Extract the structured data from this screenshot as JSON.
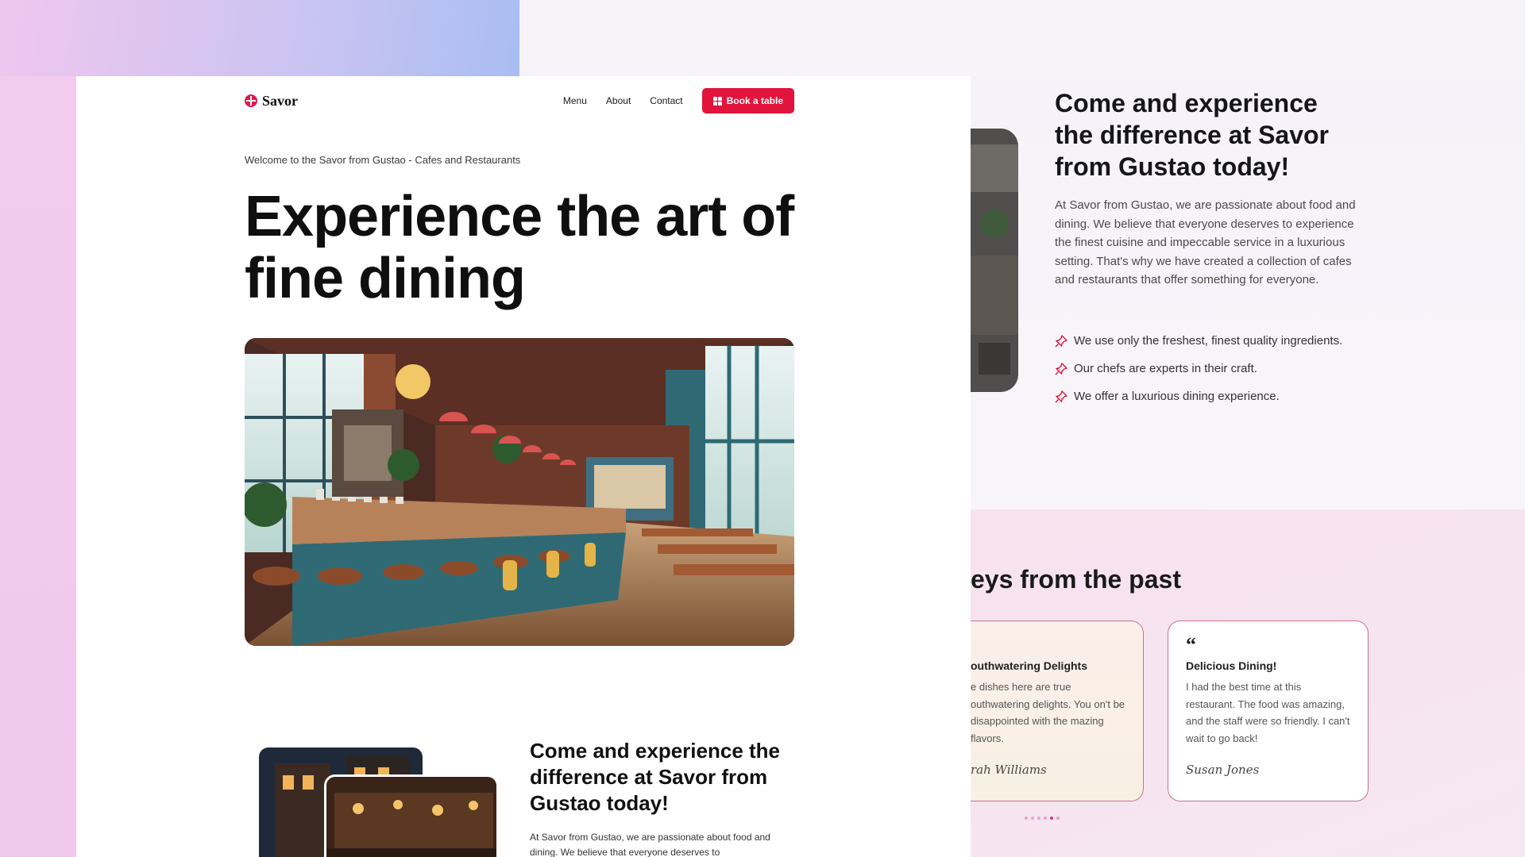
{
  "brand": {
    "name": "Savor",
    "accent": "#e0143c"
  },
  "nav": {
    "links": [
      {
        "label": "Menu"
      },
      {
        "label": "About"
      },
      {
        "label": "Contact"
      }
    ],
    "cta_label": "Book a table"
  },
  "hero": {
    "eyebrow": "Welcome to the Savor from Gustao - Cafes and Restaurants",
    "title": "Experience the art of fine dining"
  },
  "about": {
    "title": "Come and experience the difference at Savor from Gustao today!",
    "body": "At Savor from Gustao, we are passionate about food and dining. We believe that everyone deserves to experience the finest cuisine and impeccable service in a luxurious setting. That's why we have created a collection of cafes and restaurants that offer something for everyone.",
    "body_preview": "At Savor from Gustao, we are passionate about food and dining. We believe that everyone deserves to",
    "features": [
      "We use only the freshest, finest quality ingredients.",
      "Our chefs are experts in their craft.",
      "We offer a luxurious dining experience."
    ]
  },
  "testimonials": {
    "title_visible": "eys from the past",
    "cards": [
      {
        "title": "outhwatering Delights",
        "text": "e dishes here are true outhwatering delights. You on't be disappointed with the mazing flavors.",
        "author": "rah Williams"
      },
      {
        "title": "Delicious Dining!",
        "text": "I had the best time at this restaurant. The food was amazing, and the staff were so friendly. I can't wait to go back!",
        "author": "Susan Jones"
      }
    ],
    "dot_count": 6,
    "active_dot": 4
  }
}
